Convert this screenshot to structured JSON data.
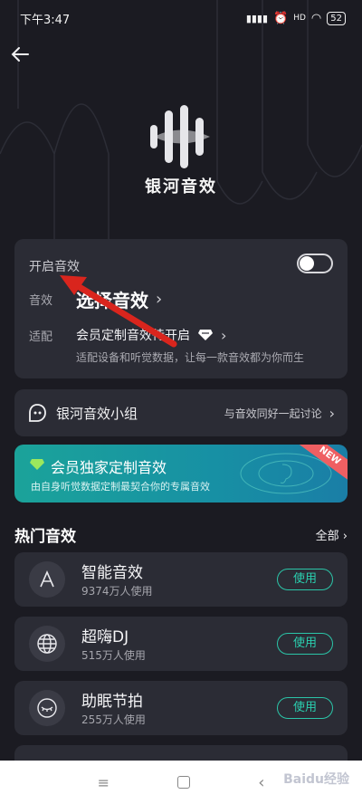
{
  "status": {
    "time": "下午3:47",
    "battery": "52",
    "hd": "HD"
  },
  "header": {
    "back_icon": "arrow-left-icon",
    "logo_text": "银河音效"
  },
  "main_card": {
    "switch_label": "开启音效",
    "toggle_on": false,
    "effect_label": "音效",
    "effect_value": "选择音效",
    "adapt_label": "适配",
    "adapt_value": "会员定制音效待开启",
    "adapt_desc": "适配设备和听觉数据，让每一款音效都为你而生"
  },
  "group": {
    "title": "银河音效小组",
    "subtitle": "与音效同好一起讨论"
  },
  "vip": {
    "title": "会员独家定制音效",
    "subtitle": "由自身听觉数据定制最契合你的专属音效",
    "tag": "NEW"
  },
  "hot": {
    "title": "热门音效",
    "all_label": "全部",
    "items": [
      {
        "name": "智能音效",
        "users": "9374万人使用",
        "button": "使用",
        "icon": "letter-a-icon"
      },
      {
        "name": "超嗨DJ",
        "users": "515万人使用",
        "button": "使用",
        "icon": "globe-icon"
      },
      {
        "name": "助眠节拍",
        "users": "255万人使用",
        "button": "使用",
        "icon": "sleep-eye-icon"
      }
    ]
  },
  "watermark": "Baidu经验"
}
